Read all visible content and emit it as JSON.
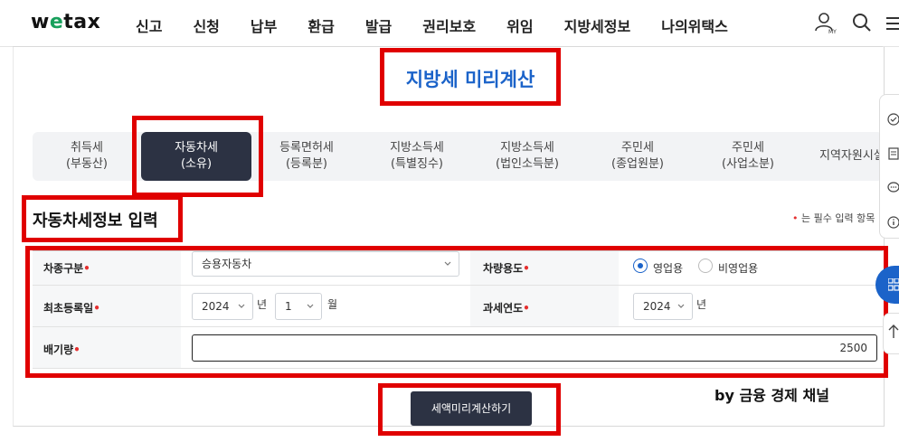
{
  "nav": {
    "logo_pre": "w",
    "logo_e": "e",
    "logo_post": "tax",
    "menu": [
      "신고",
      "신청",
      "납부",
      "환급",
      "발급",
      "권리보호",
      "위임",
      "지방세정보",
      "나의위택스"
    ],
    "user_sub": "MY"
  },
  "page": {
    "title": "지방세 미리계산"
  },
  "tabs": [
    {
      "line1": "취득세",
      "line2": "(부동산)"
    },
    {
      "line1": "자동차세",
      "line2": "(소유)"
    },
    {
      "line1": "등록면허세",
      "line2": "(등록분)"
    },
    {
      "line1": "지방소득세",
      "line2": "(특별징수)"
    },
    {
      "line1": "지방소득세",
      "line2": "(법인소득분)"
    },
    {
      "line1": "주민세",
      "line2": "(종업원분)"
    },
    {
      "line1": "주민세",
      "line2": "(사업소분)"
    },
    {
      "line1": "지역자원시설",
      "line2": ""
    }
  ],
  "active_tab_index": 1,
  "section": {
    "title": "자동차세정보 입력",
    "required_note": "는 필수 입력 항목"
  },
  "form": {
    "vehicle_type": {
      "label": "차종구분",
      "value": "승용자동차"
    },
    "vehicle_use": {
      "label": "차량용도",
      "options": [
        "영업용",
        "비영업용"
      ],
      "selected": "영업용"
    },
    "first_registration": {
      "label": "최초등록일",
      "year": "2024",
      "year_unit": "년",
      "month": "1",
      "month_unit": "월"
    },
    "tax_year": {
      "label": "과세연도",
      "year": "2024",
      "year_unit": "년"
    },
    "displacement": {
      "label": "배기량",
      "value": "2500"
    }
  },
  "calc_button": "세액미리계산하기",
  "watermark": "by 금융 경제 채널",
  "colors": {
    "accent": "#1b63c9",
    "dark": "#2c3243",
    "highlight": "#e00000",
    "required": "#e53030",
    "logo_green": "#18a05c"
  }
}
